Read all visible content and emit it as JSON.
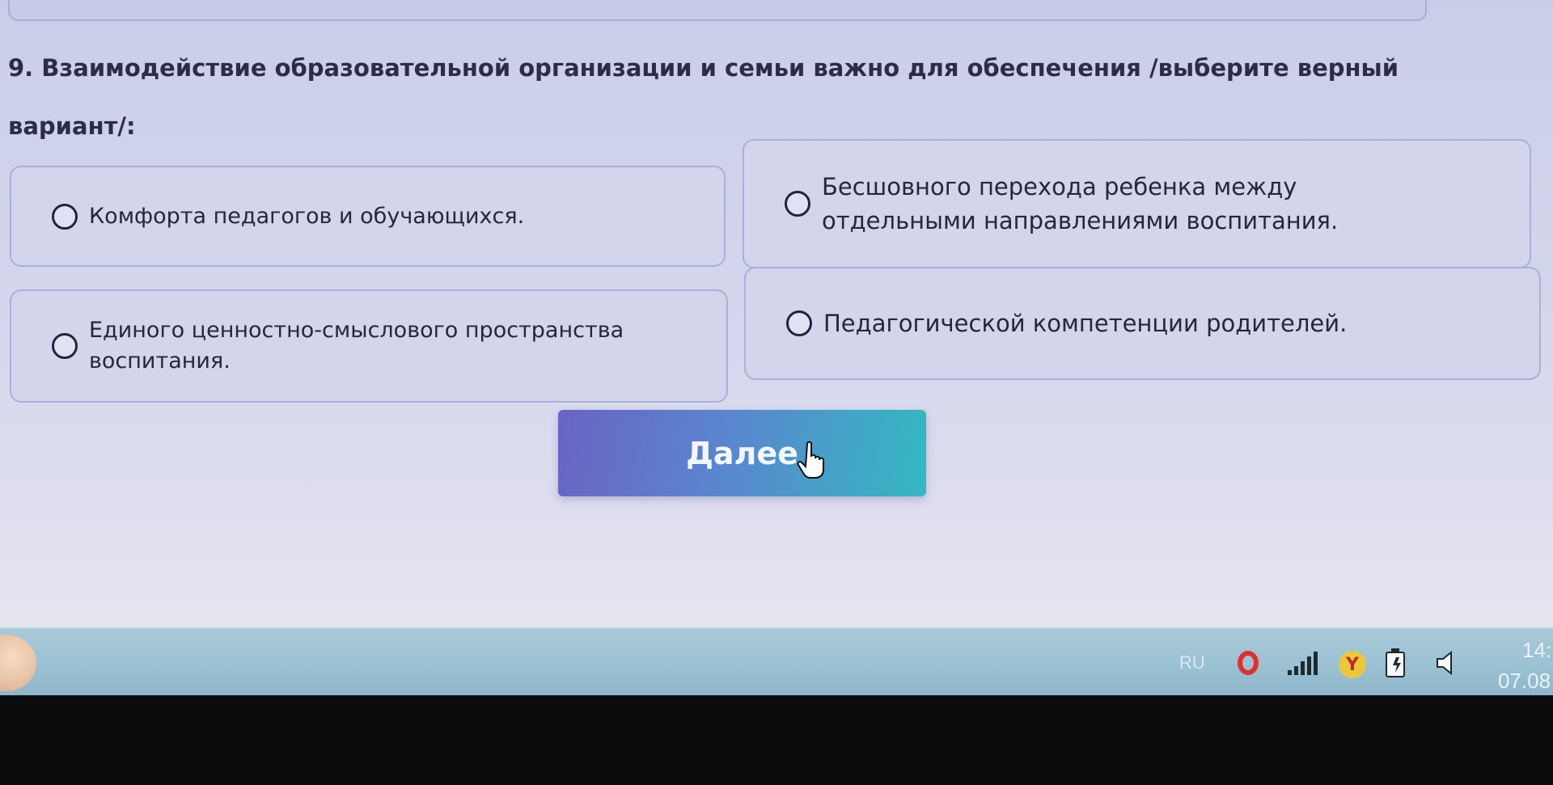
{
  "question": {
    "text": "9. Взаимодействие образовательной организации и семьи важно для обеспечения /выберите верный вариант/:"
  },
  "options": [
    {
      "label": "Комфорта педагогов и обучающихся."
    },
    {
      "label": "Бесшовного перехода ребенка между отдельными направлениями воспитания."
    },
    {
      "label": "Единого ценностно-смыслового пространства воспитания."
    },
    {
      "label": "Педагогической компетенции родителей."
    }
  ],
  "next_button": {
    "label": "Далее"
  },
  "taskbar": {
    "language": "RU",
    "clock_time": "14:",
    "clock_date": "07.08"
  },
  "icons": {
    "cursor": "hand-pointer-icon",
    "browser": "opera-icon",
    "network": "signal-bars-icon",
    "yandex": "yandex-browser-icon",
    "power": "battery-icon",
    "volume": "speaker-icon"
  },
  "colors": {
    "page_background": "#cfd4ea",
    "option_background": "#d2d5ec",
    "option_border": "#aab0d9",
    "button_gradient_start": "#6a63c4",
    "button_gradient_end": "#33b9c1",
    "taskbar": "#9cc2d3"
  }
}
